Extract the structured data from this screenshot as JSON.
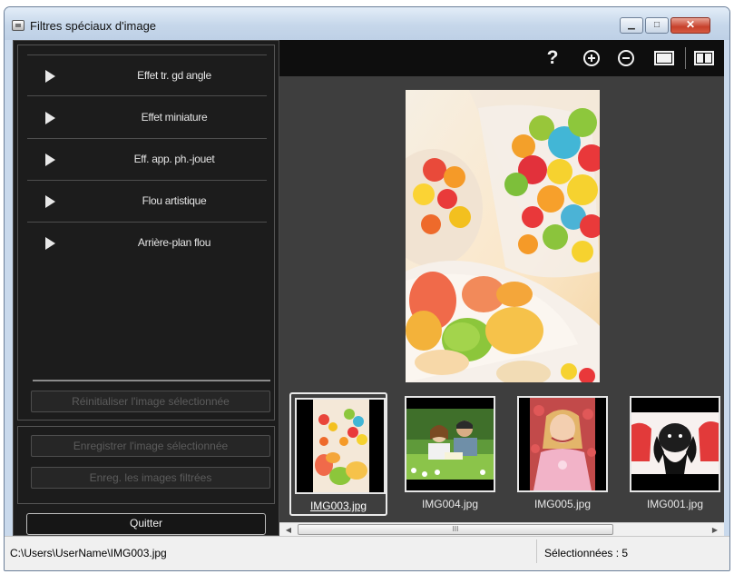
{
  "window": {
    "title": "Filtres spéciaux d'image"
  },
  "effects": [
    {
      "label": "Effet tr. gd angle"
    },
    {
      "label": "Effet miniature"
    },
    {
      "label": "Eff. app. ph.-jouet"
    },
    {
      "label": "Flou artistique"
    },
    {
      "label": "Arrière-plan flou"
    }
  ],
  "buttons": {
    "reset": "Réinitialiser l'image sélectionnée",
    "save_selected": "Enregistrer l'image sélectionnée",
    "save_filtered": "Enreg. les images filtrées",
    "quit": "Quitter"
  },
  "toolbar": {
    "help": "?"
  },
  "thumbnails": [
    {
      "name": "IMG003.jpg",
      "selected": true
    },
    {
      "name": "IMG004.jpg",
      "selected": false
    },
    {
      "name": "IMG005.jpg",
      "selected": false
    },
    {
      "name": "IMG001.jpg",
      "selected": false
    }
  ],
  "scrollbar": {
    "grip": "III"
  },
  "status": {
    "path": "C:\\Users\\UserName\\IMG003.jpg",
    "selected": "Sélectionnées : 5"
  }
}
